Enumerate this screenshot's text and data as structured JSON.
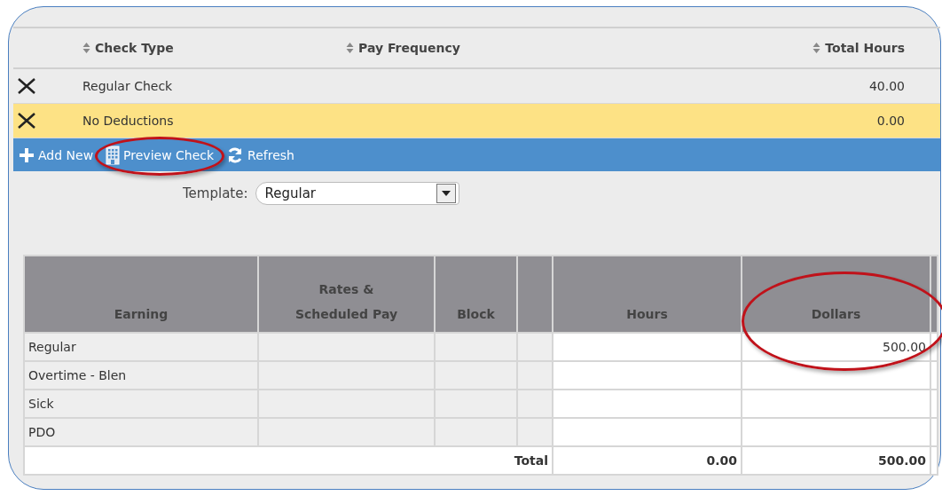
{
  "checks_grid": {
    "columns": [
      {
        "label": "Check Type"
      },
      {
        "label": "Pay Frequency"
      },
      {
        "label": "Total Hours"
      }
    ],
    "rows": [
      {
        "check_type": "Regular Check",
        "total_hours": "40.00",
        "selected": false
      },
      {
        "check_type": "No Deductions",
        "total_hours": "0.00",
        "selected": true
      }
    ]
  },
  "toolbar": [
    {
      "kind": "add",
      "label": "Add New",
      "circled": false
    },
    {
      "kind": "preview",
      "label": "Preview Check",
      "circled": true
    },
    {
      "kind": "refresh",
      "label": "Refresh",
      "circled": false
    }
  ],
  "template": {
    "label": "Template:",
    "value": "Regular"
  },
  "earnings_table": {
    "columns": [
      "Earning",
      "Rates &\nScheduled Pay",
      "Block",
      "",
      "Hours",
      "Dollars"
    ],
    "rows": [
      {
        "earning": "Regular",
        "hours": "",
        "dollars": "500.00",
        "circled": true
      },
      {
        "earning": "Overtime - Blen",
        "hours": "",
        "dollars": "",
        "circled": false
      },
      {
        "earning": "Sick",
        "hours": "",
        "dollars": "",
        "circled": false
      },
      {
        "earning": "PDO",
        "hours": "",
        "dollars": "",
        "circled": false
      }
    ],
    "total": {
      "label": "Total",
      "hours": "0.00",
      "dollars": "500.00"
    }
  }
}
